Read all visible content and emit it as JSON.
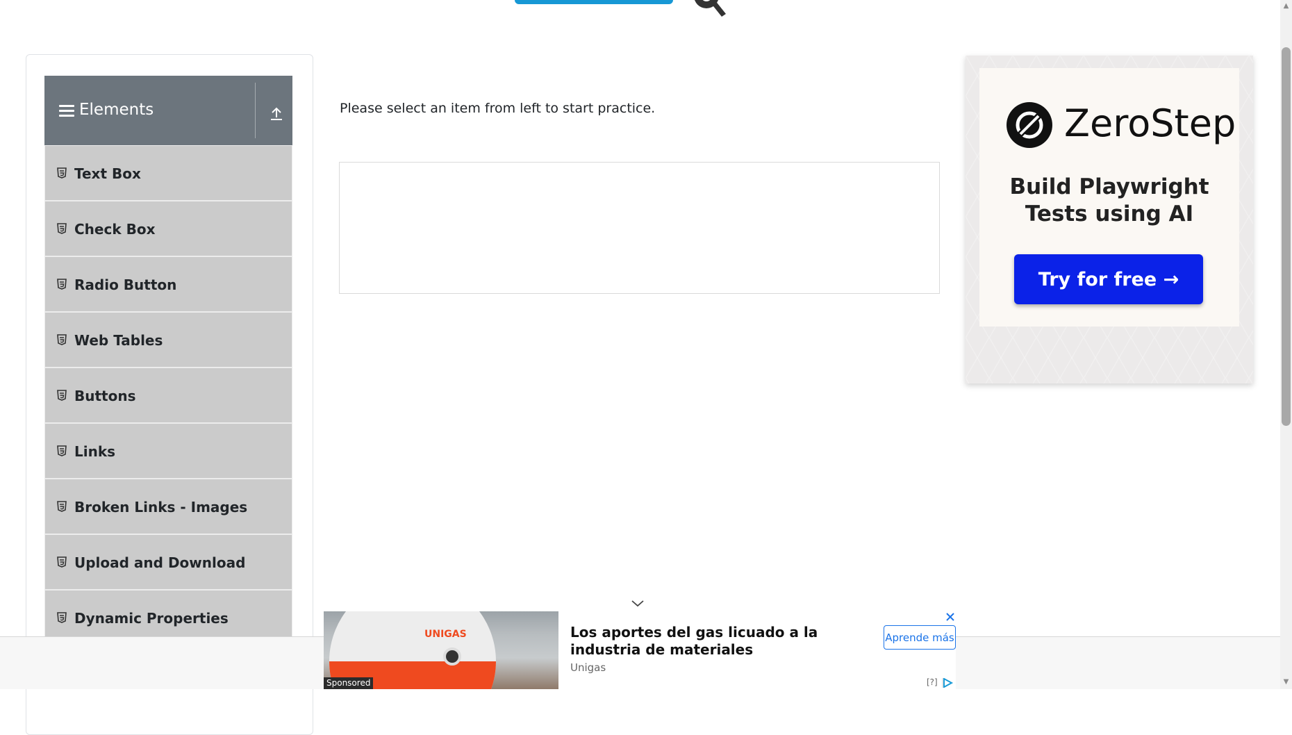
{
  "sidebar": {
    "group_title": "Elements",
    "items": [
      {
        "label": "Text Box"
      },
      {
        "label": "Check Box"
      },
      {
        "label": "Radio Button"
      },
      {
        "label": "Web Tables"
      },
      {
        "label": "Buttons"
      },
      {
        "label": "Links"
      },
      {
        "label": "Broken Links - Images"
      },
      {
        "label": "Upload and Download"
      },
      {
        "label": "Dynamic Properties"
      }
    ]
  },
  "main": {
    "intro_text": "Please select an item from left to start practice."
  },
  "ad_right": {
    "brand": "ZeroStep",
    "tagline": "Build Playwright Tests using AI",
    "cta": "Try for free →"
  },
  "ad_bottom": {
    "headline": "Los aportes del gas licuado a la industria de materiales",
    "advertiser": "Unigas",
    "cta": "Aprende más",
    "sponsored": "Sponsored",
    "info": "[?]",
    "image_text": "UNIGAS"
  },
  "colors": {
    "sidebar_header": "#6c757d",
    "menu_item_bg": "#cbcbcb",
    "cta_blue": "#0b22e8",
    "logo_blue": "#1798d5"
  }
}
